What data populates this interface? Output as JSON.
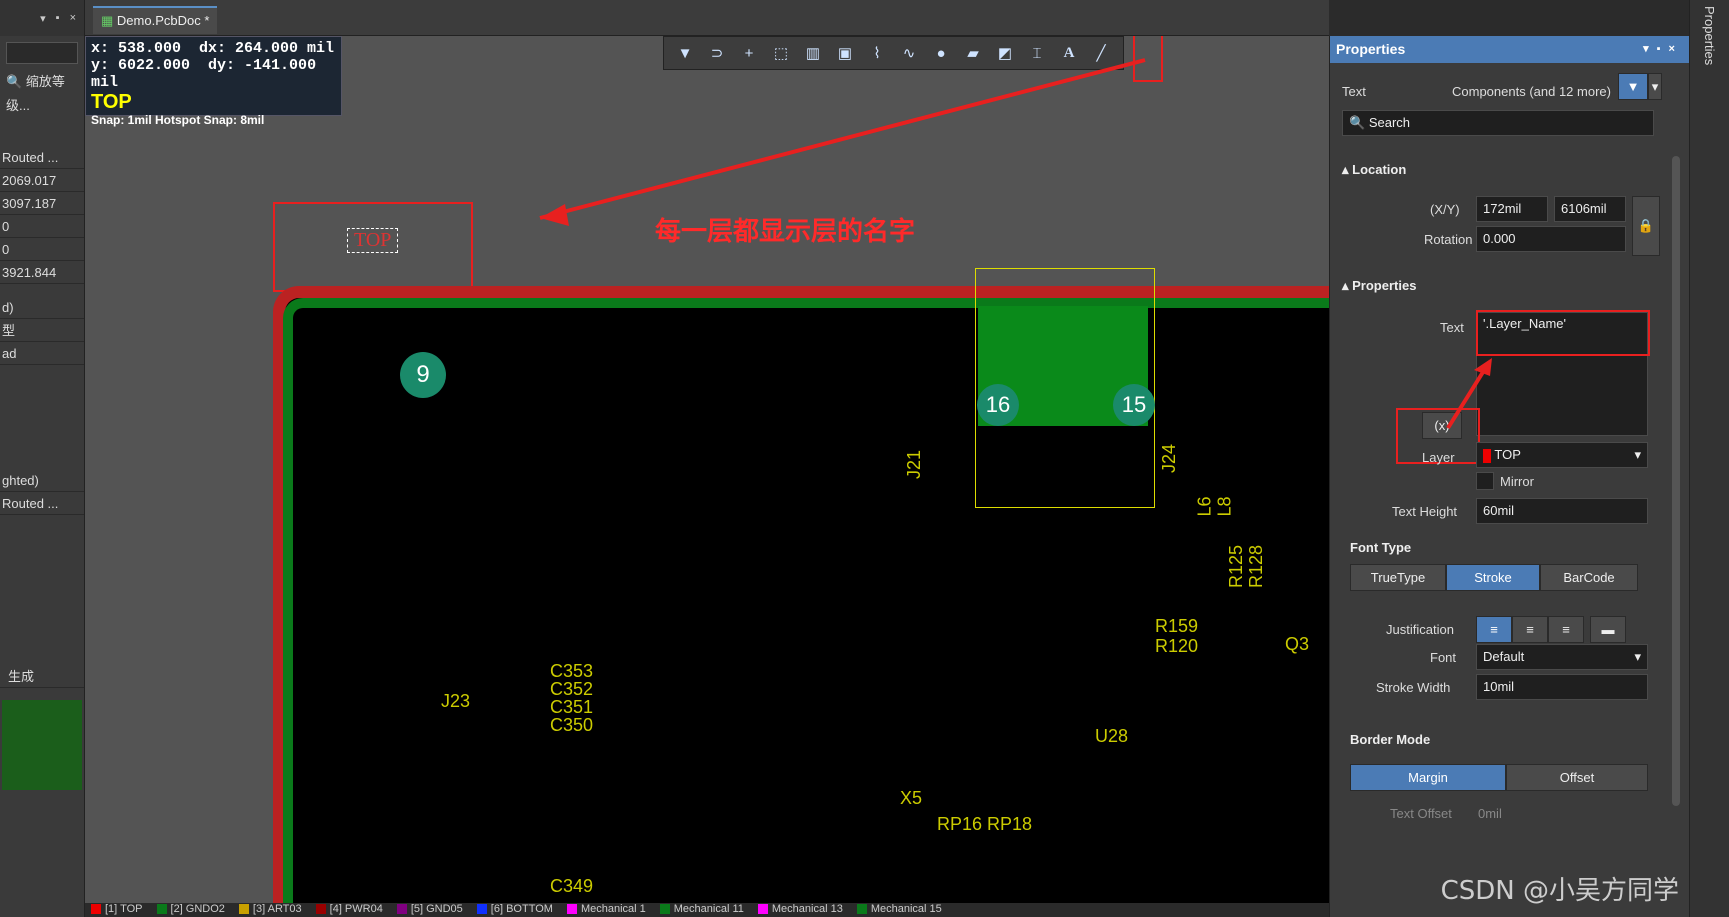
{
  "left_panel": {
    "header_icons": [
      "▾",
      "▪",
      "×"
    ],
    "zoom_label": "缩放等级...",
    "rows": [
      "Routed ...",
      "2069.017",
      "3097.187",
      "0",
      "0",
      "3921.844",
      "d)",
      "型",
      "ad",
      "ghted)",
      "Routed ...",
      "生成"
    ]
  },
  "tab": {
    "label": "Demo.PcbDoc *"
  },
  "coords": {
    "x": "x:  538.000",
    "dx": "dx:  264.000 mil",
    "y": "y:  6022.000",
    "dy": "dy:  -141.000 mil",
    "layer": "TOP",
    "snap": "Snap: 1mil Hotspot Snap: 8mil"
  },
  "canvas": {
    "annotation": "每一层都显示层的名字",
    "top_text": "TOP",
    "labels": [
      "9",
      "16",
      "15",
      "J23",
      "J21",
      "J24",
      "X5",
      "U28",
      "Q3",
      "C353",
      "C352",
      "C351",
      "C350",
      "C349",
      "R159",
      "R120",
      "RP16 RP18",
      "L6",
      "L8",
      "R125",
      "R128"
    ]
  },
  "bottom_layers": [
    {
      "name": "[1] TOP",
      "color": "#e00"
    },
    {
      "name": "[2] GNDO2",
      "color": "#0a7a1a"
    },
    {
      "name": "[3] ART03",
      "color": "#c8a000"
    },
    {
      "name": "[4] PWR04",
      "color": "#900"
    },
    {
      "name": "[5] GND05",
      "color": "#800080"
    },
    {
      "name": "[6] BOTTOM",
      "color": "#1030ff"
    },
    {
      "name": "Mechanical 1",
      "color": "#ff00ff"
    },
    {
      "name": "Mechanical 11",
      "color": "#0a7a1a"
    },
    {
      "name": "Mechanical 13",
      "color": "#ff00ff"
    },
    {
      "name": "Mechanical 15",
      "color": "#0a7a1a"
    }
  ],
  "properties": {
    "title": "Properties",
    "text_label": "Text",
    "filter": "Components (and 12 more)",
    "search_placeholder": "Search",
    "location_section": "Location",
    "xy_label": "(X/Y)",
    "x": "172mil",
    "y": "6106mil",
    "rotation_label": "Rotation",
    "rotation": "0.000",
    "props_section": "Properties",
    "text_field_label": "Text",
    "text_value": "'.Layer_Name'",
    "fx": "(x)",
    "layer_label": "Layer",
    "layer_value": "TOP",
    "mirror_label": "Mirror",
    "text_height_label": "Text Height",
    "text_height": "60mil",
    "font_type_section": "Font Type",
    "font_types": [
      "TrueType",
      "Stroke",
      "BarCode"
    ],
    "justification_label": "Justification",
    "font_label": "Font",
    "font_value": "Default",
    "stroke_width_label": "Stroke Width",
    "stroke_width": "10mil",
    "border_mode_section": "Border Mode",
    "border_modes": [
      "Margin",
      "Offset"
    ],
    "text_offset_label": "Text Offset",
    "text_offset": "0mil"
  },
  "side_tab": "Properties",
  "watermark": "CSDN @小吴方同学"
}
